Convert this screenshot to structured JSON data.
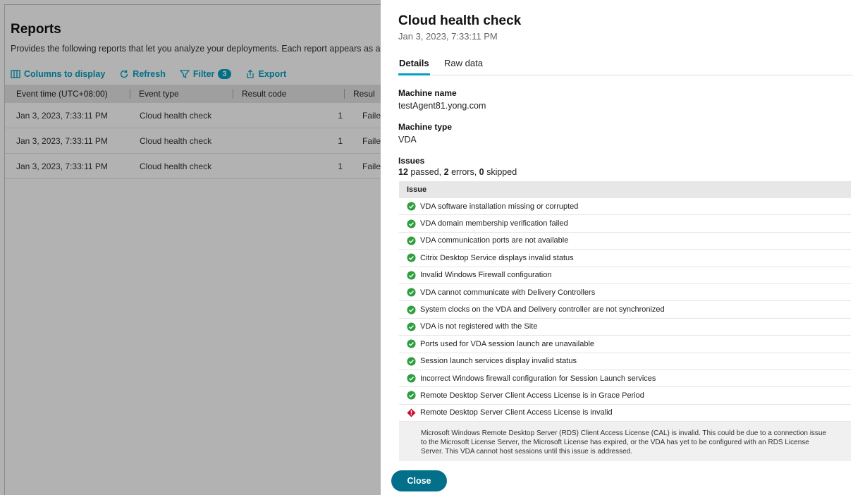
{
  "reports": {
    "title": "Reports",
    "description": "Provides the following reports that let you analyze your deployments. Each report appears as a table re",
    "toolbar": {
      "columns": "Columns to display",
      "refresh": "Refresh",
      "filter": "Filter",
      "filter_count": "3",
      "export": "Export"
    },
    "columns": [
      "Event time (UTC+08:00)",
      "Event type",
      "Result code",
      "Resul"
    ],
    "rows": [
      {
        "time": "Jan 3, 2023, 7:33:11 PM",
        "type": "Cloud health check",
        "code": "1",
        "result": "Failed"
      },
      {
        "time": "Jan 3, 2023, 7:33:11 PM",
        "type": "Cloud health check",
        "code": "1",
        "result": "Failed"
      },
      {
        "time": "Jan 3, 2023, 7:33:11 PM",
        "type": "Cloud health check",
        "code": "1",
        "result": "Failed"
      }
    ]
  },
  "drawer": {
    "title": "Cloud health check",
    "timestamp": "Jan 3, 2023, 7:33:11 PM",
    "tabs": [
      "Details",
      "Raw data"
    ],
    "machine_name_label": "Machine name",
    "machine_name": "testAgent81.yong.com",
    "machine_type_label": "Machine type",
    "machine_type": "VDA",
    "issues_label": "Issues",
    "summary": {
      "passed": "12",
      "passed_text": " passed, ",
      "errors": "2",
      "errors_text": " errors, ",
      "skipped": "0",
      "skipped_text": " skipped"
    },
    "issue_header": "Issue",
    "issues": [
      {
        "status": "pass",
        "text": "VDA software installation missing or corrupted"
      },
      {
        "status": "pass",
        "text": "VDA domain membership verification failed"
      },
      {
        "status": "pass",
        "text": "VDA communication ports are not available"
      },
      {
        "status": "pass",
        "text": "Citrix Desktop Service displays invalid status"
      },
      {
        "status": "pass",
        "text": "Invalid Windows Firewall configuration"
      },
      {
        "status": "pass",
        "text": "VDA cannot communicate with Delivery Controllers"
      },
      {
        "status": "pass",
        "text": "System clocks on the VDA and Delivery controller are not synchronized"
      },
      {
        "status": "pass",
        "text": "VDA is not registered with the Site"
      },
      {
        "status": "pass",
        "text": "Ports used for VDA session launch are unavailable"
      },
      {
        "status": "pass",
        "text": "Session launch services display invalid status"
      },
      {
        "status": "pass",
        "text": "Incorrect Windows firewall configuration for Session Launch services"
      },
      {
        "status": "pass",
        "text": "Remote Desktop Server Client Access License is in Grace Period"
      },
      {
        "status": "error",
        "text": "Remote Desktop Server Client Access License is invalid"
      }
    ],
    "error_detail": "Microsoft Windows Remote Desktop Server (RDS) Client Access License (CAL) is invalid. This could be due to a connection issue to the Microsoft License Server, the Microsoft License has expired, or the VDA has yet to be configured with an RDS License Server. This VDA cannot host sessions until this issue is addressed.",
    "close_label": "Close"
  },
  "colors": {
    "accent": "#02a1c1",
    "button": "#02708a",
    "pass": "#2e9e3e",
    "error": "#c8102e"
  }
}
